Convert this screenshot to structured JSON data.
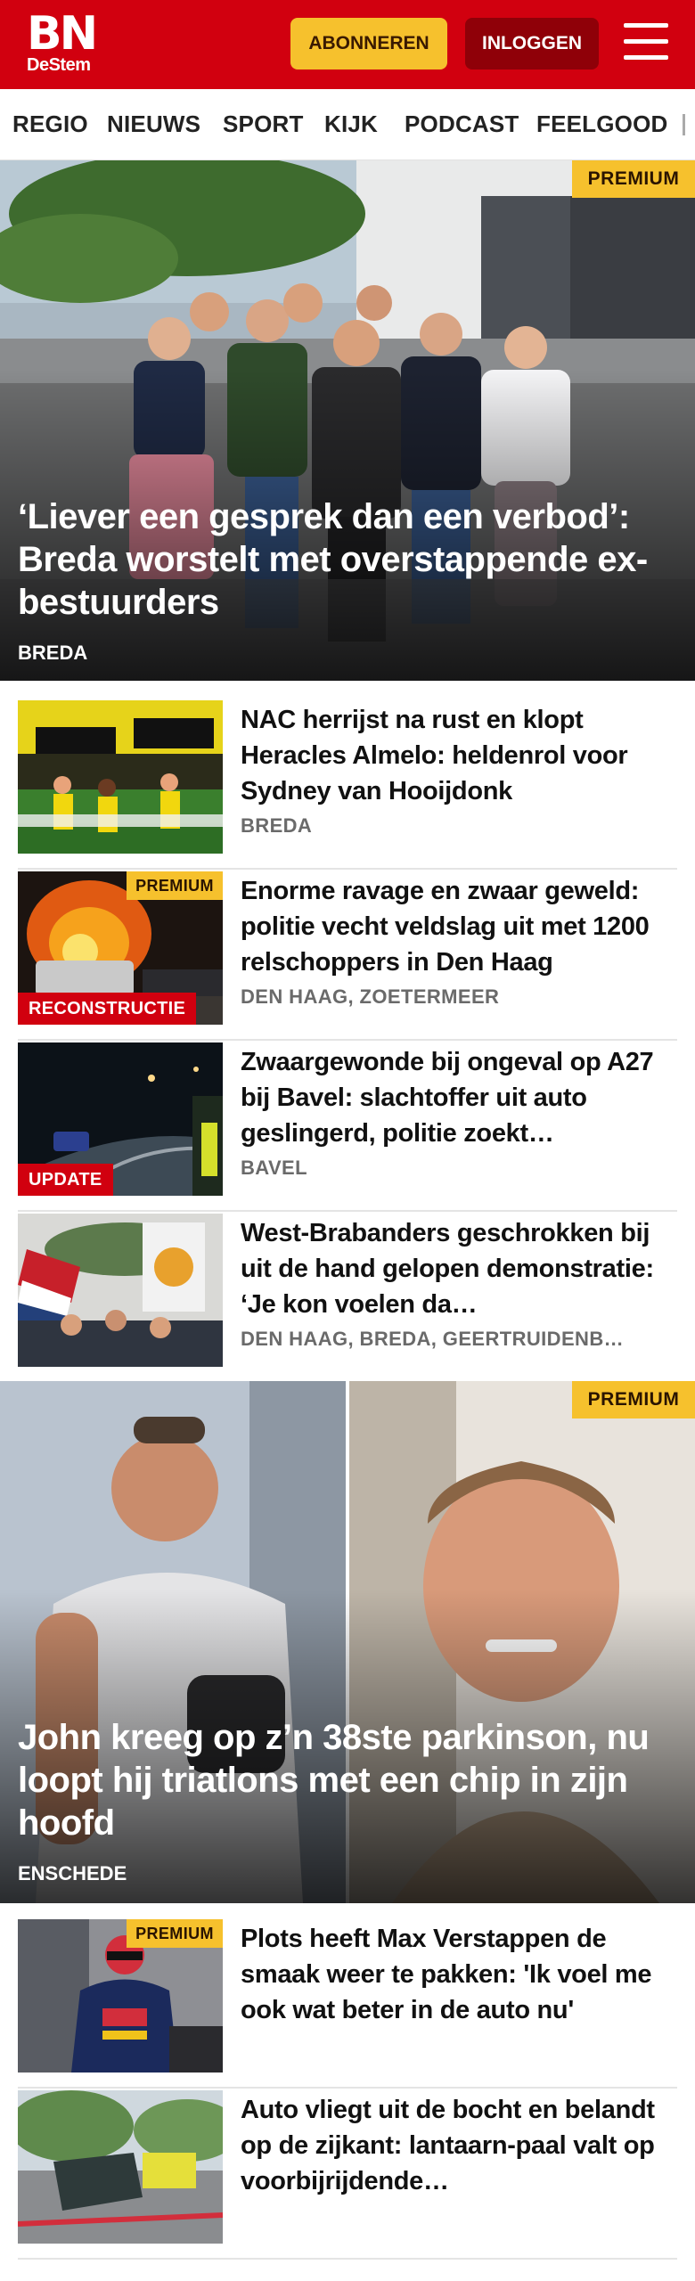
{
  "header": {
    "logo_main": "BN",
    "logo_sub": "DeStem",
    "subscribe_label": "ABONNEREN",
    "login_label": "INLOGGEN"
  },
  "nav": {
    "items": [
      "REGIO",
      "NIEUWS",
      "SPORT",
      "KIJK",
      "PODCAST",
      "FEELGOOD"
    ]
  },
  "hero_1": {
    "badge": "PREMIUM",
    "title": "‘Liever een gesprek dan een verbod’: Breda worstelt met overstappende ex-bestuurders",
    "location": "BREDA"
  },
  "list_1": [
    {
      "title": "NAC herrijst na rust en klopt Heracles Almelo: heldenrol voor Sydney van Hooijdonk",
      "location": "BREDA",
      "tag": "",
      "premium": ""
    },
    {
      "title": "Enorme ravage en zwaar geweld: politie vecht veldslag uit met 1200 relschoppers in Den Haag",
      "location": "DEN HAAG, ZOETERMEER",
      "tag": "RECONSTRUCTIE",
      "premium": "PREMIUM"
    },
    {
      "title": "Zwaargewonde bij ongeval op A27 bij Bavel: slachtoffer uit auto geslingerd, politie zoekt…",
      "location": "BAVEL",
      "tag": "UPDATE",
      "premium": ""
    },
    {
      "title": "West-Brabanders geschrokken bij uit de hand gelopen demonstratie: ‘Je kon voelen da…",
      "location": "DEN HAAG, BREDA, GEERTRUIDENB…",
      "tag": "",
      "premium": ""
    }
  ],
  "hero_2": {
    "badge": "PREMIUM",
    "title": "John kreeg op z’n 38ste parkinson, nu loopt hij triatlons met een chip in zijn hoofd",
    "location": "ENSCHEDE"
  },
  "list_2": [
    {
      "title": "Plots heeft Max Verstappen de smaak weer te pakken: 'Ik voel me ook wat beter in de auto nu'",
      "location": "",
      "tag": "",
      "premium": "PREMIUM"
    },
    {
      "title": "Auto vliegt uit de bocht en belandt op de zijkant: lantaarn-paal valt op voorbijrijdende…",
      "location": "",
      "tag": "",
      "premium": ""
    }
  ],
  "colors": {
    "brand_red": "#d1000f",
    "premium_yellow": "#f6c12d",
    "login_dark_red": "#8f0008"
  }
}
